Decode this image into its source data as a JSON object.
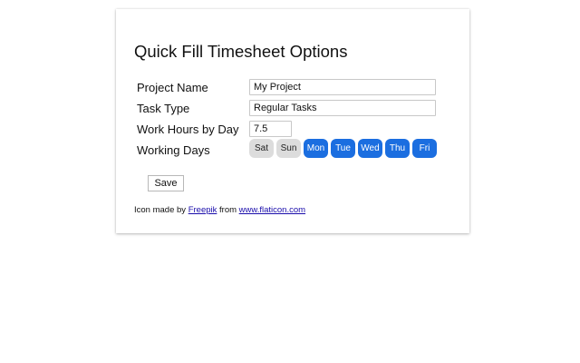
{
  "options": {
    "title": "Quick Fill Timesheet Options",
    "fields": {
      "project_name": {
        "label": "Project Name",
        "value": "My Project"
      },
      "task_type": {
        "label": "Task Type",
        "value": "Regular Tasks"
      },
      "work_hours": {
        "label": "Work Hours by Day",
        "value": "7.5"
      },
      "working_days": {
        "label": "Working Days",
        "days": [
          {
            "label": "Sat",
            "selected": false
          },
          {
            "label": "Sun",
            "selected": false
          },
          {
            "label": "Mon",
            "selected": true
          },
          {
            "label": "Tue",
            "selected": true
          },
          {
            "label": "Wed",
            "selected": true
          },
          {
            "label": "Thu",
            "selected": true
          },
          {
            "label": "Fri",
            "selected": true
          }
        ]
      }
    },
    "save_label": "Save"
  },
  "credit": {
    "prefix": "Icon made by",
    "author_link": "Freepik",
    "middle": "from",
    "site_link": "www.flaticon.com"
  },
  "colors": {
    "selected_day": "#1b6ee0",
    "unselected_day": "#dcdcdc",
    "link": "#1a0dab"
  }
}
